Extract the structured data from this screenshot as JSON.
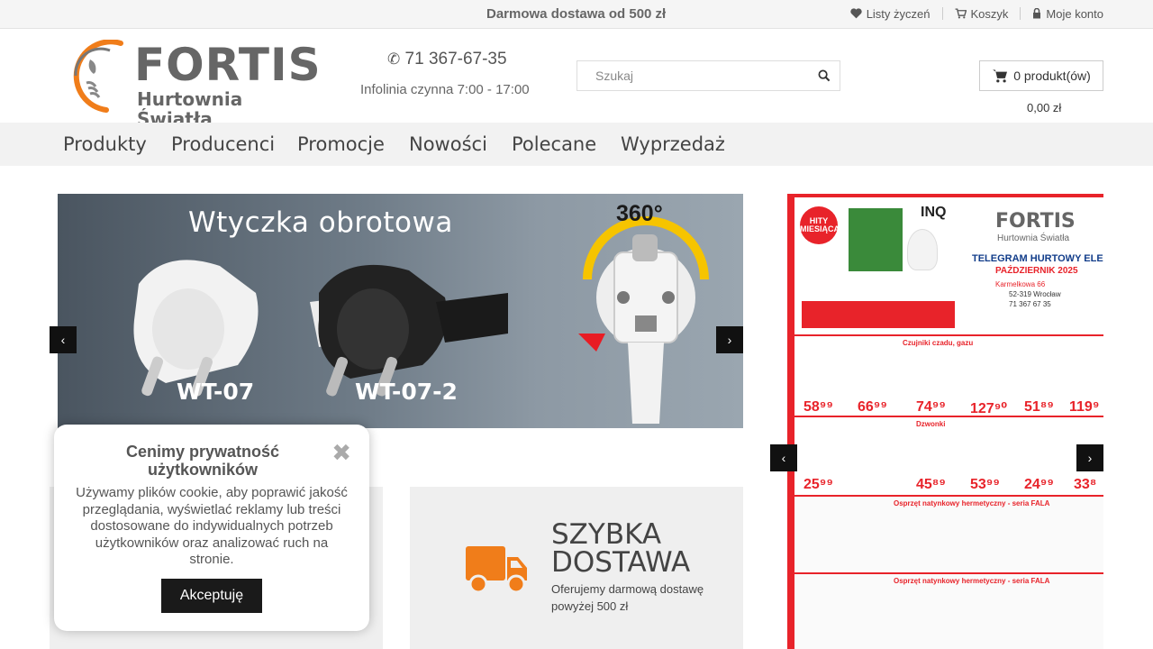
{
  "topbar": {
    "promo": "Darmowa dostawa od 500 zł",
    "links": [
      {
        "label": "Listy życzeń",
        "icon": "heart-icon"
      },
      {
        "label": "Koszyk",
        "icon": "cart-icon"
      },
      {
        "label": "Moje konto",
        "icon": "lock-icon"
      }
    ]
  },
  "header": {
    "logo": {
      "brand": "FORTIS",
      "tagline": "Hurtownia Światła"
    },
    "phone": "71 367-67-35",
    "hours": "Infolinia czynna 7:00 - 17:00",
    "search": {
      "placeholder": "Szukaj",
      "value": ""
    },
    "cart": {
      "summary": "0 produkt(ów)",
      "total": "0,00 zł"
    }
  },
  "nav": {
    "items": [
      "Produkty",
      "Producenci",
      "Promocje",
      "Nowości",
      "Polecane",
      "Wyprzedaż"
    ]
  },
  "slider": {
    "headline": "Wtyczka obrotowa",
    "degrees": "360°",
    "model_1": "WT-07",
    "model_2": "WT-07-2",
    "prev": "‹",
    "next": "›"
  },
  "leaflet": {
    "badge": "HITY MIESIĄCA",
    "brand": "FORTIS",
    "tagline": "Hurtownia Światła",
    "headline": "TELEGRAM HURTOWY ELEKTR",
    "month": "PAŹDZIERNIK 2025",
    "address": "Karmelkowa 66",
    "city": "52-319 Wrocław",
    "phone": "71 367 67 35",
    "inq": "INQ",
    "prices": [
      "58⁹⁹",
      "66⁹⁹",
      "74⁹⁹",
      "127⁹⁰",
      "51⁸⁹",
      "119⁹",
      "25⁹⁹",
      "45⁸⁹",
      "53⁹⁹",
      "24⁹⁹",
      "33⁸"
    ],
    "sections": [
      "Czujniki czadu, gazu",
      "Dzwonki",
      "Osprzęt natynkowy hermetyczny - seria FALA",
      "Osprzęt natynkowy hermetyczny - seria FALA"
    ]
  },
  "feature": {
    "title_line1": "SZYBKA",
    "title_line2": "DOSTAWA",
    "desc": "Oferujemy darmową dostawę powyżej 500 zł"
  },
  "cookie": {
    "title": "Cenimy prywatność użytkowników",
    "text": "Używamy plików cookie, aby poprawić jakość przeglądania, wyświetlać reklamy lub treści dostosowane do indywidualnych potrzeb użytkowników oraz analizować ruch na stronie.",
    "accept": "Akceptuję",
    "close": "✖"
  },
  "colors": {
    "accent": "#f07d1a",
    "leaflet_red": "#e8232a",
    "dark": "#111111"
  }
}
